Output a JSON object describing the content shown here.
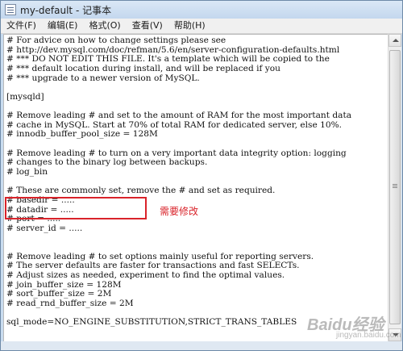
{
  "window": {
    "title": "my-default - 记事本"
  },
  "menubar": {
    "items": [
      "文件(F)",
      "编辑(E)",
      "格式(O)",
      "查看(V)",
      "帮助(H)"
    ]
  },
  "editor": {
    "lines": [
      "# For advice on how to change settings please see",
      "# http://dev.mysql.com/doc/refman/5.6/en/server-configuration-defaults.html",
      "# *** DO NOT EDIT THIS FILE. It's a template which will be copied to the",
      "# *** default location during install, and will be replaced if you",
      "# *** upgrade to a newer version of MySQL.",
      "",
      "[mysqld]",
      "",
      "# Remove leading # and set to the amount of RAM for the most important data",
      "# cache in MySQL. Start at 70% of total RAM for dedicated server, else 10%.",
      "# innodb_buffer_pool_size = 128M",
      "",
      "# Remove leading # to turn on a very important data integrity option: logging",
      "# changes to the binary log between backups.",
      "# log_bin",
      "",
      "# These are commonly set, remove the # and set as required.",
      "# basedir = .....",
      "# datadir = .....",
      "# port = .....",
      "# server_id = .....",
      "",
      "",
      "# Remove leading # to set options mainly useful for reporting servers.",
      "# The server defaults are faster for transactions and fast SELECTs.",
      "# Adjust sizes as needed, experiment to find the optimal values.",
      "# join_buffer_size = 128M",
      "# sort_buffer_size = 2M",
      "# read_rnd_buffer_size = 2M",
      "",
      "sql_mode=NO_ENGINE_SUBSTITUTION,STRICT_TRANS_TABLES"
    ]
  },
  "annotation": {
    "text": "需要修改",
    "color": "#d9232a"
  },
  "watermark": {
    "main": "Baidu经验",
    "sub": "jingyan.baidu.com"
  }
}
